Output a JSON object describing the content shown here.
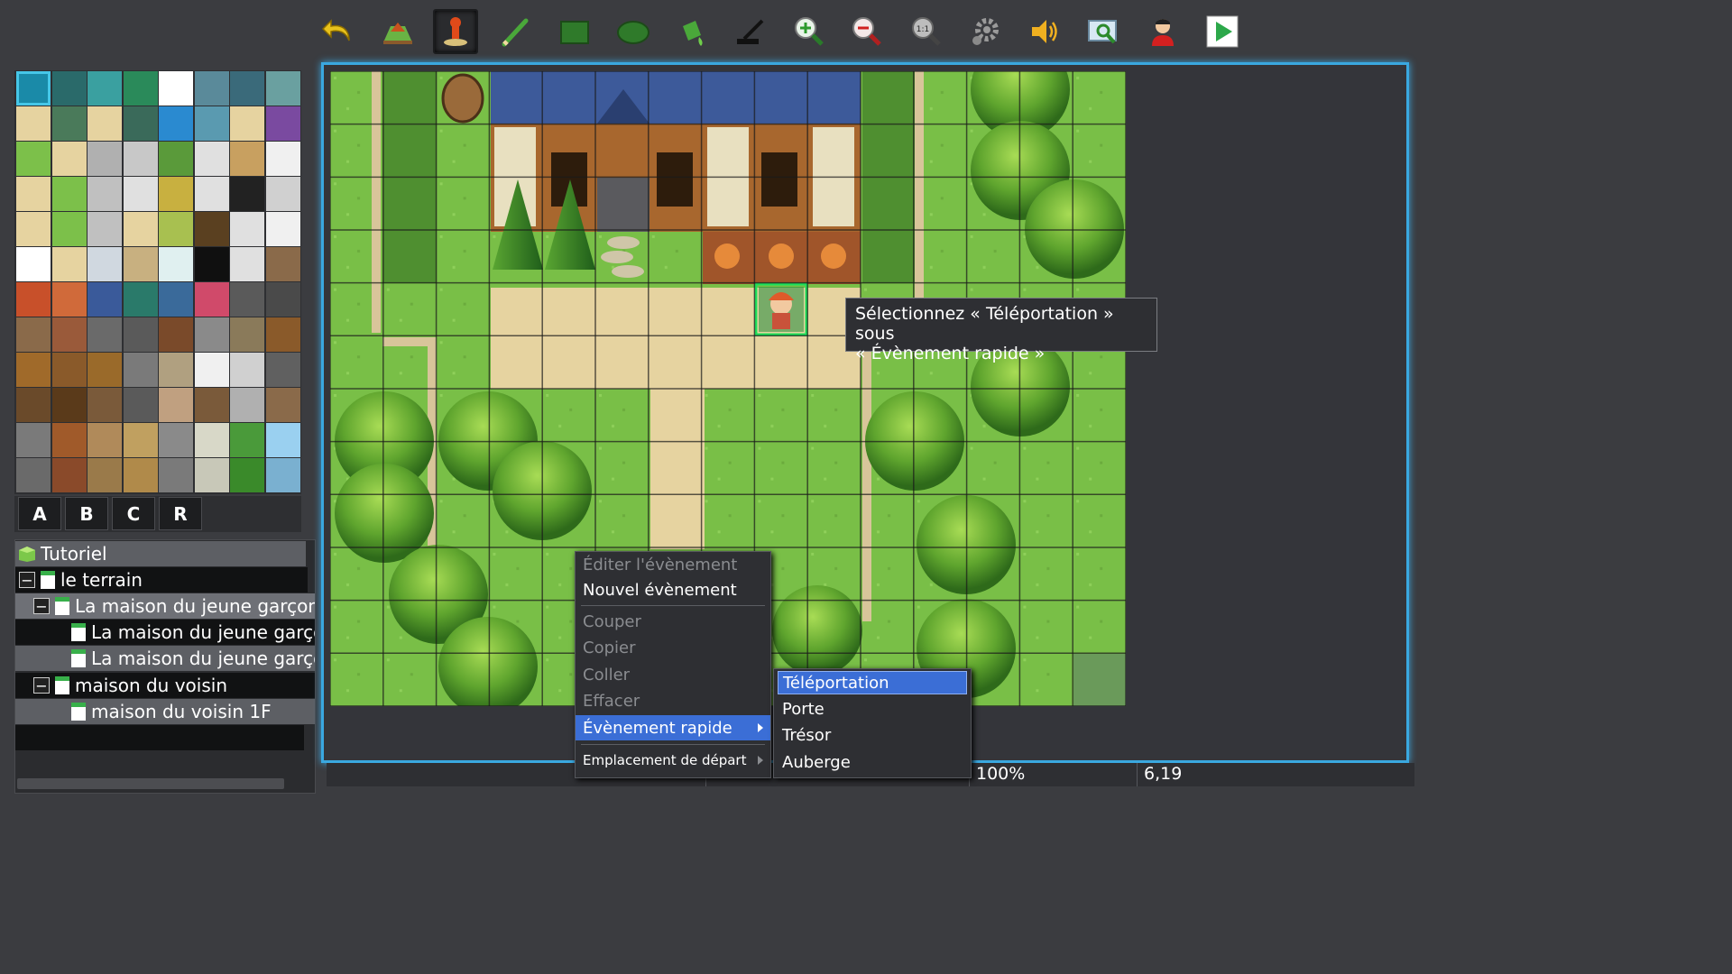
{
  "toolbar": {
    "buttons": [
      {
        "name": "undo-icon"
      },
      {
        "name": "map-layer-icon"
      },
      {
        "name": "event-layer-icon",
        "active": true
      },
      {
        "name": "pencil-icon"
      },
      {
        "name": "rectangle-icon"
      },
      {
        "name": "ellipse-icon"
      },
      {
        "name": "fill-bucket-icon"
      },
      {
        "name": "shadow-pen-icon"
      },
      {
        "name": "zoom-in-icon"
      },
      {
        "name": "zoom-out-icon"
      },
      {
        "name": "zoom-actual-icon"
      },
      {
        "name": "database-gear-icon"
      },
      {
        "name": "sound-test-icon"
      },
      {
        "name": "resource-manager-icon"
      },
      {
        "name": "character-generator-icon"
      },
      {
        "name": "playtest-icon"
      }
    ]
  },
  "palette_tabs": [
    "A",
    "B",
    "C",
    "R"
  ],
  "map_tree": {
    "root": "Tutoriel",
    "items": [
      {
        "label": "le terrain",
        "level": 1,
        "expander": "−"
      },
      {
        "label": "La maison du jeune garçon",
        "level": 2,
        "expander": "−",
        "selected": true
      },
      {
        "label": "La maison du jeune garço",
        "level": 3
      },
      {
        "label": "La maison du jeune garço",
        "level": 3
      },
      {
        "label": "maison du voisin",
        "level": 2,
        "expander": "−"
      },
      {
        "label": "maison du voisin 1F",
        "level": 3
      }
    ]
  },
  "tooltip": {
    "line1": "Sélectionnez « Téléportation » sous",
    "line2": "« Évènement rapide »"
  },
  "context_menu": {
    "items": [
      {
        "label": "Éditer l'évènement",
        "disabled": true
      },
      {
        "label": "Nouvel évènement",
        "disabled": false
      },
      {
        "label": "Couper",
        "disabled": true
      },
      {
        "label": "Copier",
        "disabled": true
      },
      {
        "label": "Coller",
        "disabled": true
      },
      {
        "label": "Effacer",
        "disabled": true
      },
      {
        "label": "Évènement rapide",
        "highlighted": true,
        "submenu": true
      },
      {
        "label": "Emplacement de départ",
        "submenu": true
      }
    ]
  },
  "submenu": {
    "items": [
      {
        "label": "Téléportation",
        "highlighted": true
      },
      {
        "label": "Porte"
      },
      {
        "label": "Trésor"
      },
      {
        "label": "Auberge"
      }
    ]
  },
  "status": {
    "zoom": "100%",
    "coords": "6,19"
  },
  "colors": {
    "accent": "#3aa8e0",
    "highlight": "#3b6ed6",
    "grass": "#7cc04a"
  }
}
